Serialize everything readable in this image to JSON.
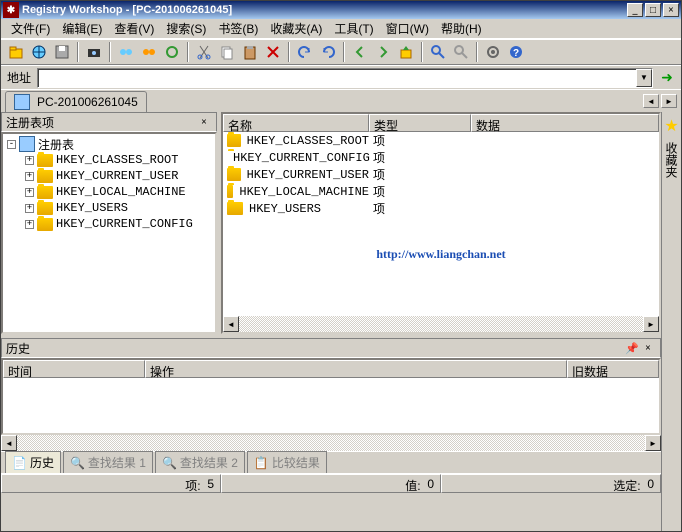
{
  "title": "Registry Workshop - [PC-201006261045]",
  "menu": [
    "文件(F)",
    "编辑(E)",
    "查看(V)",
    "搜索(S)",
    "书签(B)",
    "收藏夹(A)",
    "工具(T)",
    "窗口(W)",
    "帮助(H)"
  ],
  "addrLabel": "地址",
  "wsTab": {
    "label": "PC-201006261045"
  },
  "leftPanel": {
    "title": "注册表项"
  },
  "tree": {
    "root": "注册表",
    "keys": [
      "HKEY_CLASSES_ROOT",
      "HKEY_CURRENT_USER",
      "HKEY_LOCAL_MACHINE",
      "HKEY_USERS",
      "HKEY_CURRENT_CONFIG"
    ]
  },
  "list": {
    "cols": [
      "名称",
      "类型",
      "数据"
    ],
    "rows": [
      {
        "name": "HKEY_CLASSES_ROOT",
        "type": "项"
      },
      {
        "name": "HKEY_CURRENT_CONFIG",
        "type": "项"
      },
      {
        "name": "HKEY_CURRENT_USER",
        "type": "项"
      },
      {
        "name": "HKEY_LOCAL_MACHINE",
        "type": "项"
      },
      {
        "name": "HKEY_USERS",
        "type": "项"
      }
    ],
    "watermark": "http://www.liangchan.net"
  },
  "sidebar": {
    "label": "收藏夹"
  },
  "history": {
    "title": "历史",
    "cols": [
      "时间",
      "操作",
      "旧数据"
    ]
  },
  "bottomTabs": [
    "历史",
    "查找结果 1",
    "查找结果 2",
    "比较结果"
  ],
  "status": {
    "items_label": "项:",
    "items": "5",
    "values_label": "值:",
    "values": "0",
    "sel_label": "选定:",
    "sel": "0"
  }
}
